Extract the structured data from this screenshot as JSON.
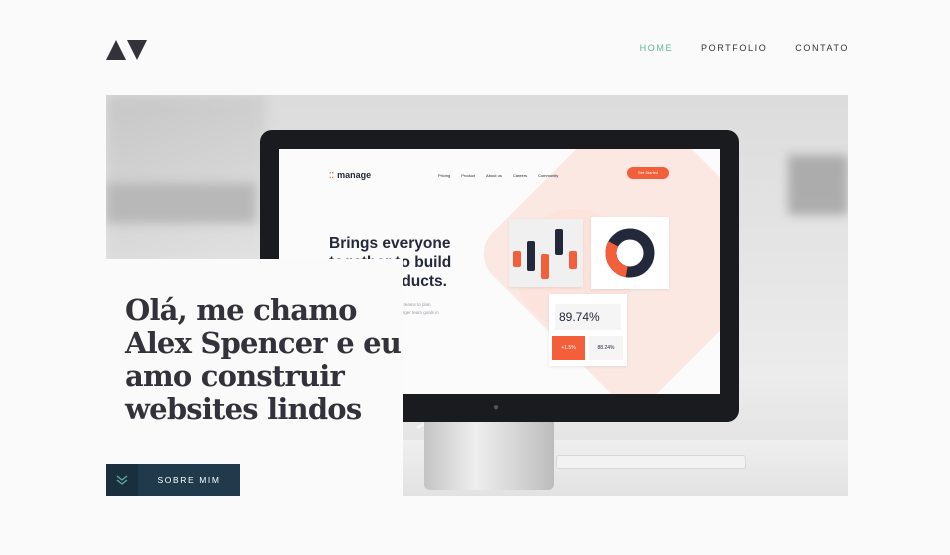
{
  "header": {
    "logo_icon": "triangle-logo-icon",
    "nav": [
      {
        "label": "HOME",
        "active": true
      },
      {
        "label": "PORTFOLIO",
        "active": false
      },
      {
        "label": "CONTATO",
        "active": false
      }
    ]
  },
  "hero": {
    "image_description_icon": "monitor-mockup",
    "screen": {
      "logo_text": "manage",
      "nav": [
        "Pricing",
        "Product",
        "About us",
        "Careers",
        "Community"
      ],
      "cta_label": "Get Started",
      "headline": "Brings everyone together to build better products.",
      "subtext": "Manage makes it simple for software teams to plan day-to-day tasks while keeping the larger team goals in view.",
      "stat_main": "89.74%",
      "stat_change": "+1.5%",
      "stat_secondary": "88.24%"
    }
  },
  "intro": {
    "title": "Olá, me chamo Alex Spencer e eu amo construir websites lindos"
  },
  "cta": {
    "label": "SOBRE MIM",
    "icon": "chevrons-down-icon"
  },
  "colors": {
    "accent_green": "#5fb49c",
    "button_navy": "#203a4c",
    "text_dark": "#33323a",
    "screen_orange": "#f25f3a",
    "screen_navy": "#24283b"
  }
}
